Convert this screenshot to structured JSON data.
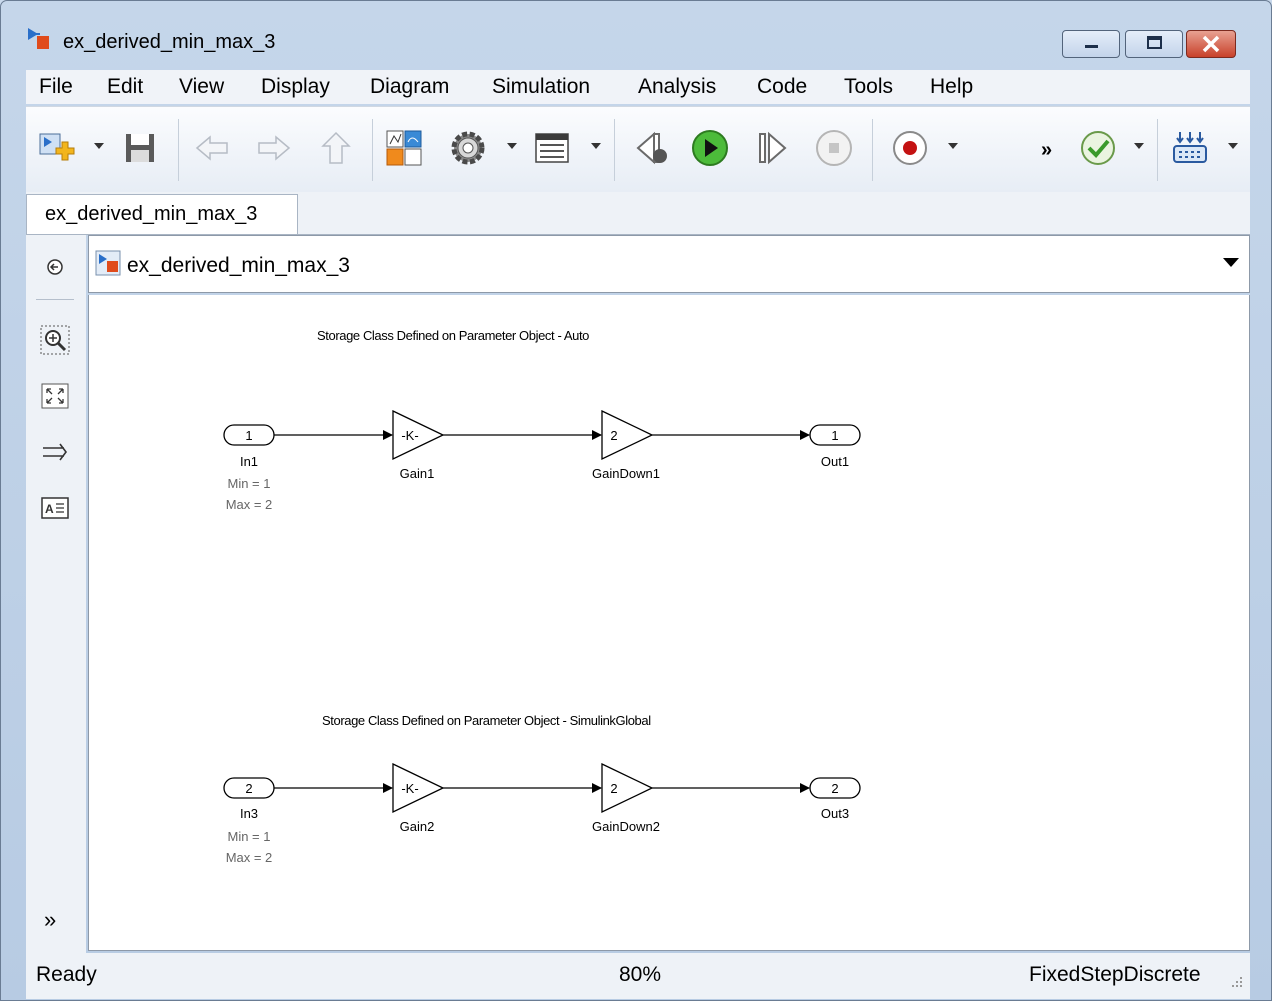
{
  "window": {
    "title": "ex_derived_min_max_3"
  },
  "menu": [
    "File",
    "Edit",
    "View",
    "Display",
    "Diagram",
    "Simulation",
    "Analysis",
    "Code",
    "Tools",
    "Help"
  ],
  "toolbar": {
    "overflow": "»"
  },
  "tabs": [
    {
      "label": "ex_derived_min_max_3"
    }
  ],
  "address": {
    "path": "ex_derived_min_max_3"
  },
  "leftbar": {
    "expand": "»"
  },
  "diagram": {
    "group1": {
      "annotation": "Storage Class Defined on Parameter Object - Auto",
      "inport": {
        "number": "1",
        "name": "In1",
        "min": "Min = 1",
        "max": "Max = 2"
      },
      "gain": {
        "value": "-K-",
        "name": "Gain1"
      },
      "gain_down": {
        "value": "2",
        "name": "GainDown1"
      },
      "outport": {
        "number": "1",
        "name": "Out1"
      }
    },
    "group2": {
      "annotation": "Storage Class Defined on Parameter Object - SimulinkGlobal",
      "inport": {
        "number": "2",
        "name": "In3",
        "min": "Min = 1",
        "max": "Max = 2"
      },
      "gain": {
        "value": "-K-",
        "name": "Gain2"
      },
      "gain_down": {
        "value": "2",
        "name": "GainDown2"
      },
      "outport": {
        "number": "2",
        "name": "Out3"
      }
    }
  },
  "status": {
    "left": "Ready",
    "zoom": "80%",
    "solver": "FixedStepDiscrete"
  }
}
